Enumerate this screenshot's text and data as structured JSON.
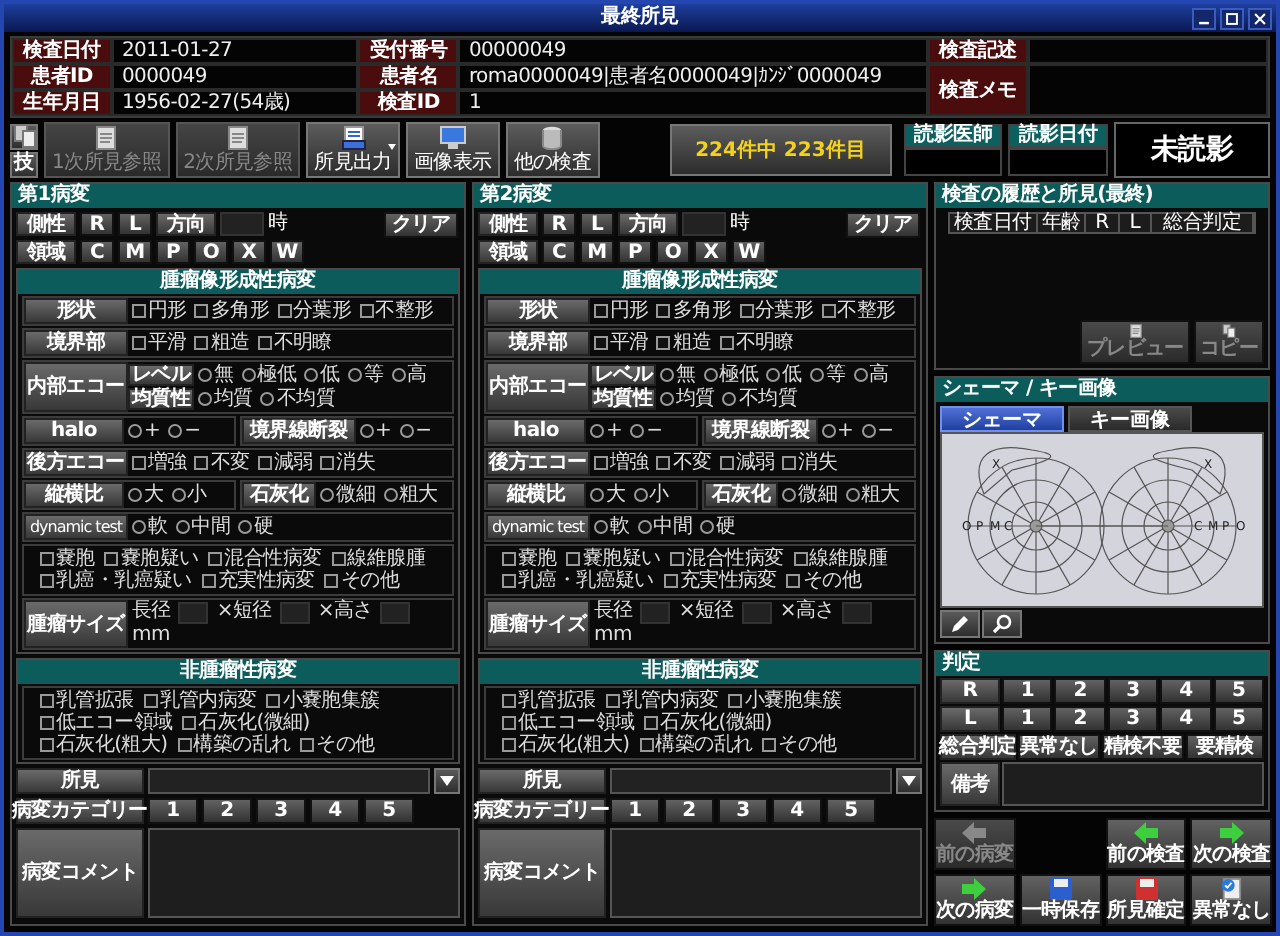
{
  "window": {
    "title": "最終所見"
  },
  "header": {
    "fields": [
      {
        "label": "検査日付",
        "value": "2011-01-27"
      },
      {
        "label": "受付番号",
        "value": "00000049"
      },
      {
        "label": "患者ID",
        "value": "0000049"
      },
      {
        "label": "患者名",
        "value": "roma0000049|患者名0000049|ｶﾝｼﾞ0000049"
      },
      {
        "label": "生年月日",
        "value": "1956-02-27(54歳)"
      },
      {
        "label": "検査ID",
        "value": "1"
      }
    ],
    "notes": [
      {
        "label": "検査記述"
      },
      {
        "label": "検査メモ"
      }
    ]
  },
  "toolbar": {
    "small": [
      {
        "kind": "copy"
      },
      {
        "kind": "text",
        "label": "技"
      }
    ],
    "buttons": [
      {
        "label": "1次所見参照",
        "disabled": true,
        "dropdown": false
      },
      {
        "label": "2次所見参照",
        "disabled": true,
        "dropdown": false
      },
      {
        "label": "所見出力",
        "disabled": false,
        "dropdown": true
      },
      {
        "label": "画像表示",
        "disabled": false,
        "dropdown": false
      },
      {
        "label": "他の検査",
        "disabled": false,
        "dropdown": false
      }
    ],
    "counter": "224件中 223件目"
  },
  "reading": {
    "fields": [
      {
        "label": "読影医師"
      },
      {
        "label": "読影日付"
      }
    ],
    "status": "未読影"
  },
  "lesions": [
    {
      "title": "第1病変",
      "clear": "クリア",
      "side": {
        "label": "側性",
        "options": [
          "R",
          "L"
        ]
      },
      "direction": {
        "label": "方向",
        "unit": "時"
      },
      "region": {
        "label": "領域",
        "options": [
          "C",
          "M",
          "P",
          "O",
          "X",
          "W"
        ]
      },
      "tumor": {
        "title": "腫瘤像形成性病変",
        "rows": [
          {
            "kind": "checks",
            "label": "形状",
            "options": [
              {
                "label": "円形",
                "checked": false
              },
              {
                "label": "多角形",
                "checked": false
              },
              {
                "label": "分葉形",
                "checked": false
              },
              {
                "label": "不整形",
                "checked": false
              }
            ]
          },
          {
            "kind": "checks",
            "label": "境界部",
            "options": [
              {
                "label": "平滑",
                "checked": false
              },
              {
                "label": "粗造",
                "checked": false
              },
              {
                "label": "不明瞭",
                "checked": false
              }
            ]
          },
          {
            "kind": "echo",
            "label": "内部エコー",
            "subrows": [
              {
                "label": "レベル",
                "options": [
                  {
                    "label": "無",
                    "selected": false
                  },
                  {
                    "label": "極低",
                    "selected": false
                  },
                  {
                    "label": "低",
                    "selected": false
                  },
                  {
                    "label": "等",
                    "selected": false
                  },
                  {
                    "label": "高",
                    "selected": false
                  }
                ]
              },
              {
                "label": "均質性",
                "options": [
                  {
                    "label": "均質",
                    "selected": false
                  },
                  {
                    "label": "不均質",
                    "selected": false
                  }
                ]
              }
            ]
          },
          {
            "kind": "split",
            "parts": [
              {
                "label": "halo",
                "options": [
                  {
                    "label": "+",
                    "selected": false
                  },
                  {
                    "label": "−",
                    "selected": false
                  }
                ]
              },
              {
                "label": "境界線断裂",
                "options": [
                  {
                    "label": "+",
                    "selected": false
                  },
                  {
                    "label": "−",
                    "selected": false
                  }
                ]
              }
            ]
          },
          {
            "kind": "checks",
            "label": "後方エコー",
            "options": [
              {
                "label": "増強",
                "checked": false
              },
              {
                "label": "不変",
                "checked": false
              },
              {
                "label": "減弱",
                "checked": false
              },
              {
                "label": "消失",
                "checked": false
              }
            ]
          },
          {
            "kind": "split",
            "parts": [
              {
                "label": "縦横比",
                "options": [
                  {
                    "label": "大",
                    "selected": false
                  },
                  {
                    "label": "小",
                    "selected": false
                  }
                ]
              },
              {
                "label": "石灰化",
                "options": [
                  {
                    "label": "微細",
                    "selected": false
                  },
                  {
                    "label": "粗大",
                    "selected": false
                  }
                ]
              }
            ]
          },
          {
            "kind": "radios",
            "label": "dynamic test",
            "options": [
              {
                "label": "軟",
                "selected": false
              },
              {
                "label": "中間",
                "selected": false
              },
              {
                "label": "硬",
                "selected": false
              }
            ]
          },
          {
            "kind": "extra",
            "options": [
              {
                "label": "嚢胞",
                "checked": false
              },
              {
                "label": "嚢胞疑い",
                "checked": false
              },
              {
                "label": "混合性病変",
                "checked": false
              },
              {
                "label": "線維腺腫",
                "checked": false
              },
              {
                "label": "乳癌・乳癌疑い",
                "checked": false
              },
              {
                "label": "充実性病変",
                "checked": false
              },
              {
                "label": "その他",
                "checked": false
              }
            ]
          },
          {
            "kind": "size",
            "label": "腫瘤サイズ",
            "fields": [
              "長径",
              "×短径",
              "×高さ"
            ],
            "unit": "mm"
          }
        ]
      },
      "nontumor": {
        "title": "非腫瘤性病変",
        "options": [
          {
            "label": "乳管拡張",
            "checked": false
          },
          {
            "label": "乳管内病変",
            "checked": false
          },
          {
            "label": "小嚢胞集簇",
            "checked": false
          },
          {
            "label": "低エコー領域",
            "checked": false
          },
          {
            "label": "石灰化(微細)",
            "checked": false
          },
          {
            "label": "石灰化(粗大)",
            "checked": false
          },
          {
            "label": "構築の乱れ",
            "checked": false
          },
          {
            "label": "その他",
            "checked": false
          }
        ]
      },
      "findings": {
        "label": "所見"
      },
      "category": {
        "label": "病変カテゴリー",
        "options": [
          "1",
          "2",
          "3",
          "4",
          "5"
        ]
      },
      "comment": {
        "label": "病変コメント"
      }
    },
    {
      "title": "第2病変",
      "clear": "クリア",
      "side": {
        "label": "側性",
        "options": [
          "R",
          "L"
        ]
      },
      "direction": {
        "label": "方向",
        "unit": "時"
      },
      "region": {
        "label": "領域",
        "options": [
          "C",
          "M",
          "P",
          "O",
          "X",
          "W"
        ]
      },
      "tumor": {
        "title": "腫瘤像形成性病変",
        "rows": [
          {
            "kind": "checks",
            "label": "形状",
            "options": [
              {
                "label": "円形",
                "checked": false
              },
              {
                "label": "多角形",
                "checked": false
              },
              {
                "label": "分葉形",
                "checked": false
              },
              {
                "label": "不整形",
                "checked": false
              }
            ]
          },
          {
            "kind": "checks",
            "label": "境界部",
            "options": [
              {
                "label": "平滑",
                "checked": false
              },
              {
                "label": "粗造",
                "checked": false
              },
              {
                "label": "不明瞭",
                "checked": false
              }
            ]
          },
          {
            "kind": "echo",
            "label": "内部エコー",
            "subrows": [
              {
                "label": "レベル",
                "options": [
                  {
                    "label": "無",
                    "selected": false
                  },
                  {
                    "label": "極低",
                    "selected": false
                  },
                  {
                    "label": "低",
                    "selected": false
                  },
                  {
                    "label": "等",
                    "selected": false
                  },
                  {
                    "label": "高",
                    "selected": false
                  }
                ]
              },
              {
                "label": "均質性",
                "options": [
                  {
                    "label": "均質",
                    "selected": false
                  },
                  {
                    "label": "不均質",
                    "selected": false
                  }
                ]
              }
            ]
          },
          {
            "kind": "split",
            "parts": [
              {
                "label": "halo",
                "options": [
                  {
                    "label": "+",
                    "selected": false
                  },
                  {
                    "label": "−",
                    "selected": false
                  }
                ]
              },
              {
                "label": "境界線断裂",
                "options": [
                  {
                    "label": "+",
                    "selected": false
                  },
                  {
                    "label": "−",
                    "selected": false
                  }
                ]
              }
            ]
          },
          {
            "kind": "checks",
            "label": "後方エコー",
            "options": [
              {
                "label": "増強",
                "checked": false
              },
              {
                "label": "不変",
                "checked": false
              },
              {
                "label": "減弱",
                "checked": false
              },
              {
                "label": "消失",
                "checked": false
              }
            ]
          },
          {
            "kind": "split",
            "parts": [
              {
                "label": "縦横比",
                "options": [
                  {
                    "label": "大",
                    "selected": false
                  },
                  {
                    "label": "小",
                    "selected": false
                  }
                ]
              },
              {
                "label": "石灰化",
                "options": [
                  {
                    "label": "微細",
                    "selected": false
                  },
                  {
                    "label": "粗大",
                    "selected": false
                  }
                ]
              }
            ]
          },
          {
            "kind": "radios",
            "label": "dynamic test",
            "options": [
              {
                "label": "軟",
                "selected": false
              },
              {
                "label": "中間",
                "selected": false
              },
              {
                "label": "硬",
                "selected": false
              }
            ]
          },
          {
            "kind": "extra",
            "options": [
              {
                "label": "嚢胞",
                "checked": false
              },
              {
                "label": "嚢胞疑い",
                "checked": false
              },
              {
                "label": "混合性病変",
                "checked": false
              },
              {
                "label": "線維腺腫",
                "checked": false
              },
              {
                "label": "乳癌・乳癌疑い",
                "checked": false
              },
              {
                "label": "充実性病変",
                "checked": false
              },
              {
                "label": "その他",
                "checked": false
              }
            ]
          },
          {
            "kind": "size",
            "label": "腫瘤サイズ",
            "fields": [
              "長径",
              "×短径",
              "×高さ"
            ],
            "unit": "mm"
          }
        ]
      },
      "nontumor": {
        "title": "非腫瘤性病変",
        "options": [
          {
            "label": "乳管拡張",
            "checked": false
          },
          {
            "label": "乳管内病変",
            "checked": false
          },
          {
            "label": "小嚢胞集簇",
            "checked": false
          },
          {
            "label": "低エコー領域",
            "checked": false
          },
          {
            "label": "石灰化(微細)",
            "checked": false
          },
          {
            "label": "石灰化(粗大)",
            "checked": false
          },
          {
            "label": "構築の乱れ",
            "checked": false
          },
          {
            "label": "その他",
            "checked": false
          }
        ]
      },
      "findings": {
        "label": "所見"
      },
      "category": {
        "label": "病変カテゴリー",
        "options": [
          "1",
          "2",
          "3",
          "4",
          "5"
        ]
      },
      "comment": {
        "label": "病変コメント"
      }
    }
  ],
  "history": {
    "title": "検査の履歴と所見(最終)",
    "columns": [
      "検査日付",
      "年齢",
      "R",
      "L",
      "総合判定"
    ],
    "buttons": [
      {
        "label": "プレビュー",
        "disabled": true
      },
      {
        "label": "コピー",
        "disabled": true
      }
    ]
  },
  "schema": {
    "title": "シェーマ / キー画像",
    "tabs": [
      {
        "label": "シェーマ",
        "selected": true
      },
      {
        "label": "キー画像",
        "selected": false
      }
    ],
    "left_labels": [
      "O",
      "P",
      "M",
      "C"
    ],
    "right_labels": [
      "C",
      "M",
      "P",
      "O"
    ],
    "marks": [
      "X",
      "X"
    ]
  },
  "judgement": {
    "title": "判定",
    "rows": [
      {
        "label": "R",
        "options": [
          "1",
          "2",
          "3",
          "4",
          "5"
        ]
      },
      {
        "label": "L",
        "options": [
          "1",
          "2",
          "3",
          "4",
          "5"
        ]
      }
    ],
    "overall": {
      "label": "総合判定",
      "options": [
        "異常なし",
        "精検不要",
        "要精検"
      ]
    },
    "remarks": {
      "label": "備考"
    }
  },
  "nav": [
    {
      "label": "前の病変",
      "disabled": true
    },
    {
      "label": "前の検査",
      "disabled": false
    },
    {
      "label": "次の検査",
      "disabled": false
    },
    {
      "label": "次の病変",
      "disabled": false
    },
    {
      "label": "一時保存",
      "disabled": false
    },
    {
      "label": "所見確定",
      "disabled": false
    },
    {
      "label": "異常なし",
      "disabled": false
    }
  ]
}
